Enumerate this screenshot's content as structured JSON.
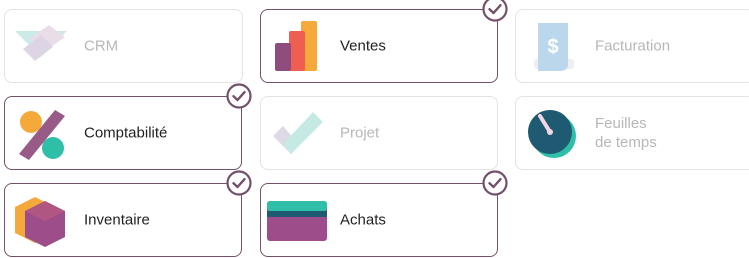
{
  "apps": [
    {
      "label": "CRM",
      "selected": false,
      "icon": "crm-icon"
    },
    {
      "label": "Ventes",
      "selected": true,
      "icon": "sales-chart-icon"
    },
    {
      "label": "Facturation",
      "selected": false,
      "icon": "invoice-dollar-icon"
    },
    {
      "label": "Comptabilité",
      "selected": true,
      "icon": "accounting-percent-icon"
    },
    {
      "label": "Projet",
      "selected": false,
      "icon": "project-check-icon"
    },
    {
      "label_line1": "Feuilles",
      "label_line2": "de temps",
      "selected": false,
      "icon": "timesheet-clock-icon"
    },
    {
      "label": "Inventaire",
      "selected": true,
      "icon": "inventory-box-icon"
    },
    {
      "label": "Achats",
      "selected": true,
      "icon": "purchase-card-icon"
    }
  ],
  "colors": {
    "selected_border": "#74506b",
    "check": "#74506b",
    "unselected_text": "#b7b7b7",
    "selected_text": "#222222"
  }
}
